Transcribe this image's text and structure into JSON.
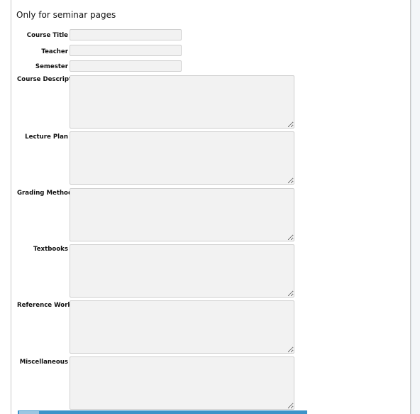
{
  "section": {
    "title": "Only for seminar pages"
  },
  "fields": {
    "course_title": {
      "label": "Course Title",
      "value": ""
    },
    "teacher": {
      "label": "Teacher",
      "value": ""
    },
    "semester": {
      "label": "Semester",
      "value": ""
    },
    "course_description": {
      "label": "Course Description",
      "value": ""
    },
    "lecture_plan": {
      "label": "Lecture Plan",
      "value": ""
    },
    "grading_method": {
      "label": "Grading Method",
      "value": ""
    },
    "textbooks": {
      "label": "Textbooks",
      "value": ""
    },
    "reference_works": {
      "label": "Reference Works",
      "value": ""
    },
    "miscellaneous": {
      "label": "Miscellaneous",
      "value": ""
    }
  },
  "colors": {
    "field_background": "#f2f2f2",
    "field_border": "#cfcfcf",
    "bottom_bar": "#3d93c9"
  }
}
